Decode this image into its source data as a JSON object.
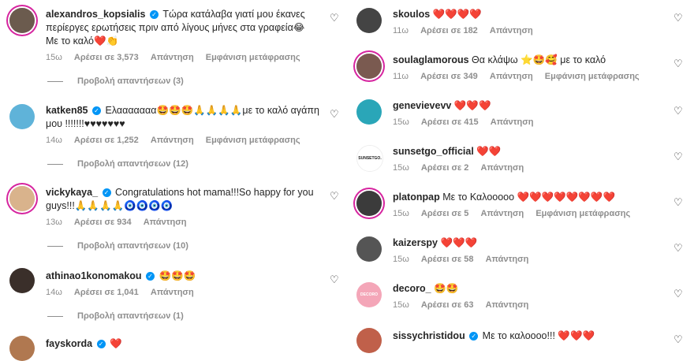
{
  "common": {
    "heart_icon": "♡",
    "verified_mark": "✓",
    "reply_label": "Απάντηση",
    "translate_label": "Εμφάνιση μετάφρασης"
  },
  "left": [
    {
      "username": "alexandros_kopsialis",
      "verified": true,
      "text_line1": "Τώρα κατάλαβα γιατί μου έκανες",
      "text_line2": "περίεργες ερωτήσεις πριν από λίγους μήνες στα γραφεία😂",
      "text_line3": "Με το καλό❤️👏",
      "time": "15ω",
      "likes": "Αρέσει σε 3,573",
      "replies": "Προβολή απαντήσεων (3)",
      "avatar_color": "#6b5b4e"
    },
    {
      "username": "katken85",
      "verified": true,
      "text_line1": "Ελααααααα🤩🤩🤩🙏🙏🙏🙏με το καλό αγάπη",
      "text_line2": "μου !!!!!!!♥♥♥♥♥♥♥",
      "time": "14ω",
      "likes": "Αρέσει σε 1,252",
      "replies": "Προβολή απαντήσεων (12)",
      "avatar_color": "#5fb3d9"
    },
    {
      "username": "vickykaya_",
      "verified": true,
      "text_line1": "Congratulations hot mama!!!So happy for you",
      "text_line2": "guys!!!🙏🙏🙏🙏🧿🧿🧿🧿",
      "time": "13ω",
      "likes": "Αρέσει σε 934",
      "replies": "Προβολή απαντήσεων (10)",
      "avatar_color": "#d9b38c"
    },
    {
      "username": "athinao1konomakou",
      "verified": true,
      "text_line1": "🤩🤩🤩",
      "time": "14ω",
      "likes": "Αρέσει σε 1,041",
      "replies": "Προβολή απαντήσεων (1)",
      "avatar_color": "#3a2f2a"
    },
    {
      "username": "fayskorda",
      "verified": true,
      "text_line1": "❤️",
      "avatar_color": "#b07850"
    }
  ],
  "right": [
    {
      "username": "skoulos",
      "verified": false,
      "text": "❤️❤️❤️❤️",
      "time": "11ω",
      "likes": "Αρέσει σε 182",
      "translate": false,
      "avatar_color": "#444444"
    },
    {
      "username": "soulaglamorous",
      "verified": false,
      "text": "Θα κλάψω ⭐🤩🥰 με το καλό",
      "time": "11ω",
      "likes": "Αρέσει σε 349",
      "translate": true,
      "avatar_color": "#7a5a50"
    },
    {
      "username": "genevievevv",
      "verified": false,
      "text": "❤️❤️❤️",
      "time": "15ω",
      "likes": "Αρέσει σε 415",
      "translate": false,
      "avatar_color": "#2aa6b8"
    },
    {
      "username": "sunsetgo_official",
      "verified": false,
      "text": "❤️❤️",
      "time": "15ω",
      "likes": "Αρέσει σε 2",
      "translate": false,
      "avatar_color": "#ffffff",
      "avatar_text": "SUNSETGO."
    },
    {
      "username": "platonpap",
      "verified": false,
      "text": "Με το Καλοοοοο ❤️❤️❤️❤️❤️❤️❤️❤️",
      "time": "15ω",
      "likes": "Αρέσει σε 5",
      "translate": true,
      "avatar_color": "#3b3b3b"
    },
    {
      "username": "kaizerspy",
      "verified": false,
      "text": "❤️❤️❤️",
      "time": "15ω",
      "likes": "Αρέσει σε 58",
      "translate": false,
      "avatar_color": "#555555"
    },
    {
      "username": "decoro_",
      "verified": false,
      "text": "🤩🤩",
      "time": "15ω",
      "likes": "Αρέσει σε 63",
      "translate": false,
      "avatar_color": "#f4a6b8",
      "avatar_text": "DECORO"
    },
    {
      "username": "sissychristidou",
      "verified": true,
      "text": "Με το καλοooo!!! ❤️❤️❤️",
      "avatar_color": "#c0604a"
    }
  ]
}
